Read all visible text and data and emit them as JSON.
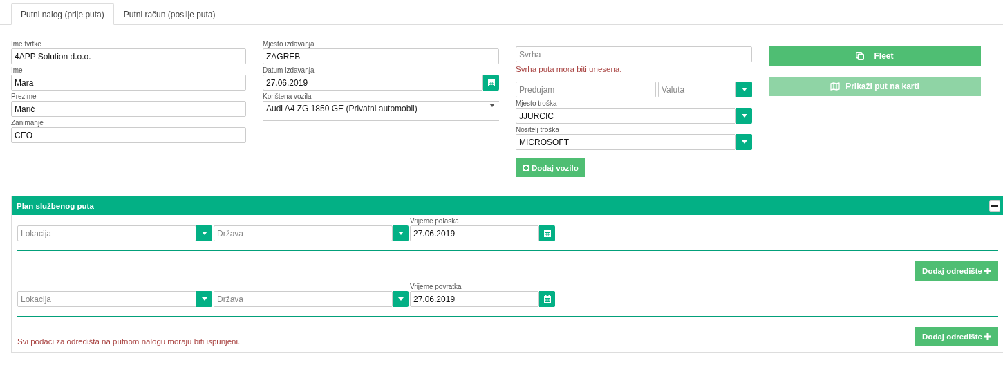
{
  "tabs": [
    {
      "label": "Putni nalog (prije puta)",
      "selected": true
    },
    {
      "label": "Putni račun (poslije puta)",
      "selected": false
    }
  ],
  "column_1": [
    {
      "kind": "text",
      "label": "Ime tvrtke",
      "value": "4APP Solution d.o.o."
    },
    {
      "kind": "text",
      "label": "Ime",
      "value": "Mara"
    },
    {
      "kind": "text",
      "label": "Prezime",
      "value": "Marić"
    },
    {
      "kind": "text",
      "label": "Zanimanje",
      "value": "CEO"
    }
  ],
  "column_2": [
    {
      "kind": "text",
      "label": "Mjesto izdavanja",
      "value": "ZAGREB"
    },
    {
      "kind": "date",
      "label": "Datum izdavanja",
      "value": "27.06.2019"
    },
    {
      "kind": "listbox",
      "label": "Korištena vozila",
      "value": "Audi A4 ZG 1850 GE (Privatni automobil)"
    }
  ],
  "purpose": {
    "placeholder": "Svrha",
    "error": "Svrha puta mora biti unesena."
  },
  "advance": {
    "placeholder": "Predujam"
  },
  "currency": {
    "placeholder": "Valuta"
  },
  "column_3": [
    {
      "kind": "select",
      "label": "Mjesto troška",
      "value": "JJURCIC"
    },
    {
      "kind": "select",
      "label": "Nositelj troška",
      "value": "MICROSOFT"
    }
  ],
  "add_vehicle_button": {
    "label": "Dodaj vozilo"
  },
  "fleet_button": {
    "label": "Fleet",
    "disabled": false
  },
  "map_button": {
    "label": "Prikaži put na karti",
    "disabled": true
  },
  "plan": {
    "title": "Plan službenog puta",
    "expanded": true,
    "legs": [
      {
        "location_placeholder": "Lokacija",
        "country_placeholder": "Država",
        "time_label": "Vrijeme polaska",
        "time_value": "27.06.2019",
        "add_button": "Dodaj odredište"
      },
      {
        "location_placeholder": "Lokacija",
        "country_placeholder": "Država",
        "time_label": "Vrijeme povratka",
        "time_value": "27.06.2019",
        "add_button": "Dodaj odredište"
      }
    ],
    "error": "Svi podaci za odredišta na putnom nalogu moraju biti ispunjeni."
  }
}
